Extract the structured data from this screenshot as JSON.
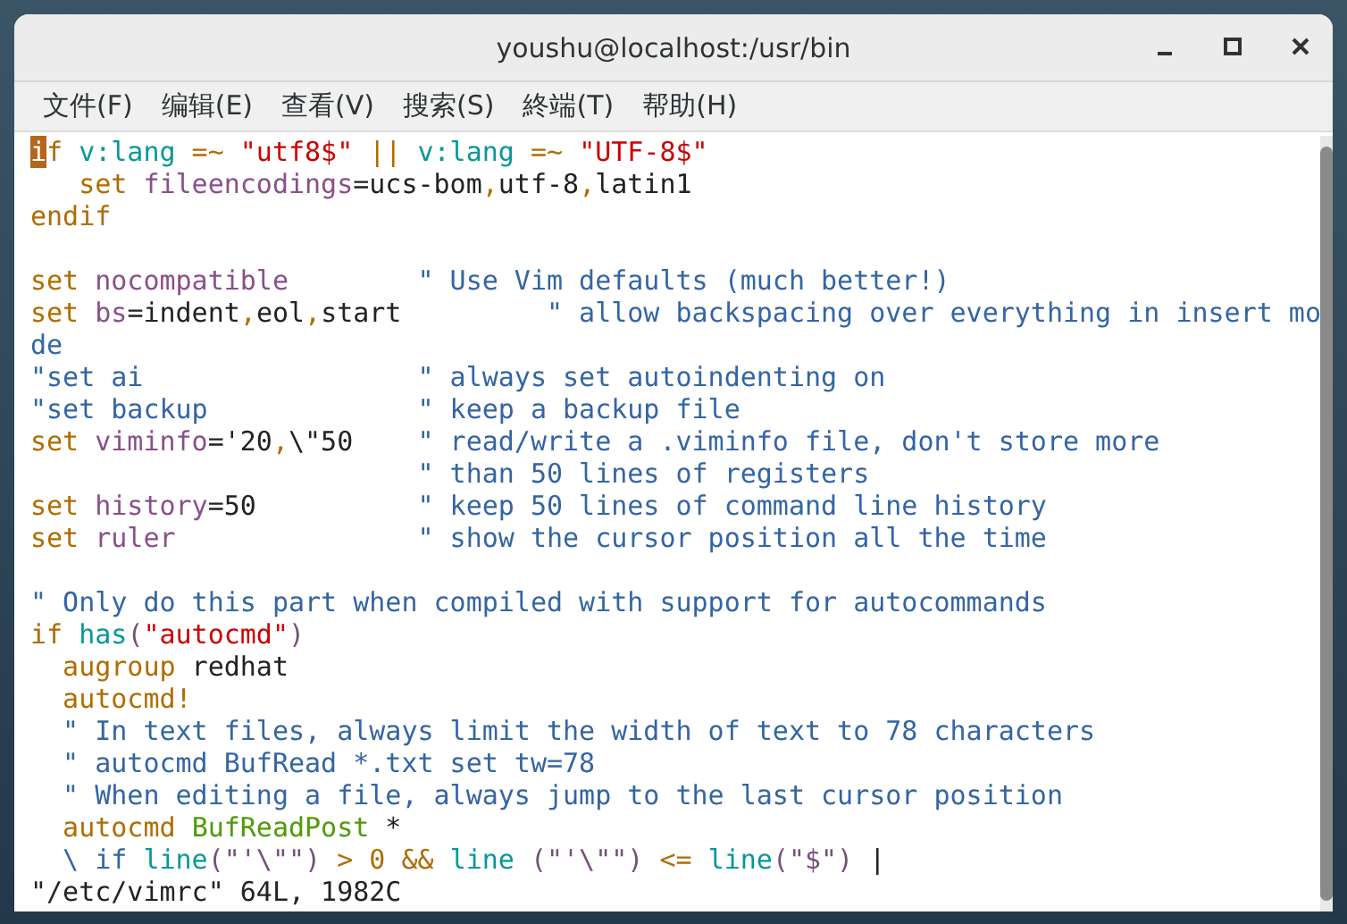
{
  "window": {
    "title": "youshu@localhost:/usr/bin"
  },
  "menu": [
    "文件(F)",
    "编辑(E)",
    "查看(V)",
    "搜索(S)",
    "終端(T)",
    "帮助(H)"
  ],
  "lines": [
    [
      {
        "kind": "cursor",
        "text": "i"
      },
      {
        "kind": "keyword",
        "text": "f "
      },
      {
        "kind": "func",
        "text": "v:lang"
      },
      {
        "kind": "op",
        "text": " =~ "
      },
      {
        "kind": "string",
        "text": "\"utf8$\""
      },
      {
        "kind": "op",
        "text": " || "
      },
      {
        "kind": "func",
        "text": "v:lang"
      },
      {
        "kind": "op",
        "text": " =~ "
      },
      {
        "kind": "string",
        "text": "\"UTF-8$\""
      }
    ],
    [
      {
        "kind": "keyword",
        "text": "   set"
      },
      {
        "kind": "ident",
        "text": " fileencodings"
      },
      {
        "kind": "plain",
        "text": "=ucs-bom"
      },
      {
        "kind": "op",
        "text": ","
      },
      {
        "kind": "plain",
        "text": "utf-8"
      },
      {
        "kind": "op",
        "text": ","
      },
      {
        "kind": "plain",
        "text": "latin1"
      }
    ],
    [
      {
        "kind": "keyword",
        "text": "endif"
      }
    ],
    [
      {
        "kind": "blank"
      }
    ],
    [
      {
        "kind": "keyword",
        "text": "set"
      },
      {
        "kind": "ident",
        "text": " nocompatible"
      },
      {
        "kind": "comment",
        "text": "        \" Use Vim defaults (much better!)"
      }
    ],
    [
      {
        "kind": "keyword",
        "text": "set"
      },
      {
        "kind": "ident",
        "text": " bs"
      },
      {
        "kind": "plain",
        "text": "=indent"
      },
      {
        "kind": "op",
        "text": ","
      },
      {
        "kind": "plain",
        "text": "eol"
      },
      {
        "kind": "op",
        "text": ","
      },
      {
        "kind": "plain",
        "text": "start"
      },
      {
        "kind": "comment",
        "text": "         \" allow backspacing over everything in insert mo"
      }
    ],
    [
      {
        "kind": "comment",
        "text": "de"
      }
    ],
    [
      {
        "kind": "comment",
        "text": "\"set ai                 \" always set autoindenting on"
      }
    ],
    [
      {
        "kind": "comment",
        "text": "\"set backup             \" keep a backup file"
      }
    ],
    [
      {
        "kind": "keyword",
        "text": "set"
      },
      {
        "kind": "ident",
        "text": " viminfo"
      },
      {
        "kind": "plain",
        "text": "='20"
      },
      {
        "kind": "op",
        "text": ","
      },
      {
        "kind": "plain",
        "text": "\\\"50"
      },
      {
        "kind": "comment",
        "text": "    \" read/write a .viminfo file, don't store more"
      }
    ],
    [
      {
        "kind": "comment",
        "text": "                        \" than 50 lines of registers"
      }
    ],
    [
      {
        "kind": "keyword",
        "text": "set"
      },
      {
        "kind": "ident",
        "text": " history"
      },
      {
        "kind": "plain",
        "text": "=50"
      },
      {
        "kind": "comment",
        "text": "          \" keep 50 lines of command line history"
      }
    ],
    [
      {
        "kind": "keyword",
        "text": "set"
      },
      {
        "kind": "ident",
        "text": " ruler"
      },
      {
        "kind": "comment",
        "text": "               \" show the cursor position all the time"
      }
    ],
    [
      {
        "kind": "blank"
      }
    ],
    [
      {
        "kind": "comment",
        "text": "\" Only do this part when compiled with support for autocommands"
      }
    ],
    [
      {
        "kind": "keyword",
        "text": "if "
      },
      {
        "kind": "func",
        "text": "has"
      },
      {
        "kind": "paren",
        "text": "("
      },
      {
        "kind": "string",
        "text": "\"autocmd\""
      },
      {
        "kind": "paren",
        "text": ")"
      }
    ],
    [
      {
        "kind": "keyword",
        "text": "  augroup"
      },
      {
        "kind": "plain",
        "text": " redhat"
      }
    ],
    [
      {
        "kind": "keyword",
        "text": "  autocmd"
      },
      {
        "kind": "op",
        "text": "!"
      }
    ],
    [
      {
        "kind": "comment",
        "text": "  \" In text files, always limit the width of text to 78 characters"
      }
    ],
    [
      {
        "kind": "comment",
        "text": "  \" autocmd BufRead *.txt set tw=78"
      }
    ],
    [
      {
        "kind": "comment",
        "text": "  \" When editing a file, always jump to the last cursor position"
      }
    ],
    [
      {
        "kind": "keyword",
        "text": "  autocmd "
      },
      {
        "kind": "type",
        "text": "BufReadPost"
      },
      {
        "kind": "plain",
        "text": " *"
      }
    ],
    [
      {
        "kind": "comment",
        "text": "  \\ if "
      },
      {
        "kind": "func",
        "text": "line"
      },
      {
        "kind": "paren",
        "text": "(\"'\\\"\")"
      },
      {
        "kind": "op",
        "text": " > 0 && "
      },
      {
        "kind": "func",
        "text": "line"
      },
      {
        "kind": "paren",
        "text": " (\"'\\\"\")"
      },
      {
        "kind": "op",
        "text": " <= "
      },
      {
        "kind": "func",
        "text": "line"
      },
      {
        "kind": "paren",
        "text": "(\"$\")"
      },
      {
        "kind": "plain",
        "text": " |"
      }
    ]
  ],
  "status_line": "\"/etc/vimrc\" 64L, 1982C"
}
